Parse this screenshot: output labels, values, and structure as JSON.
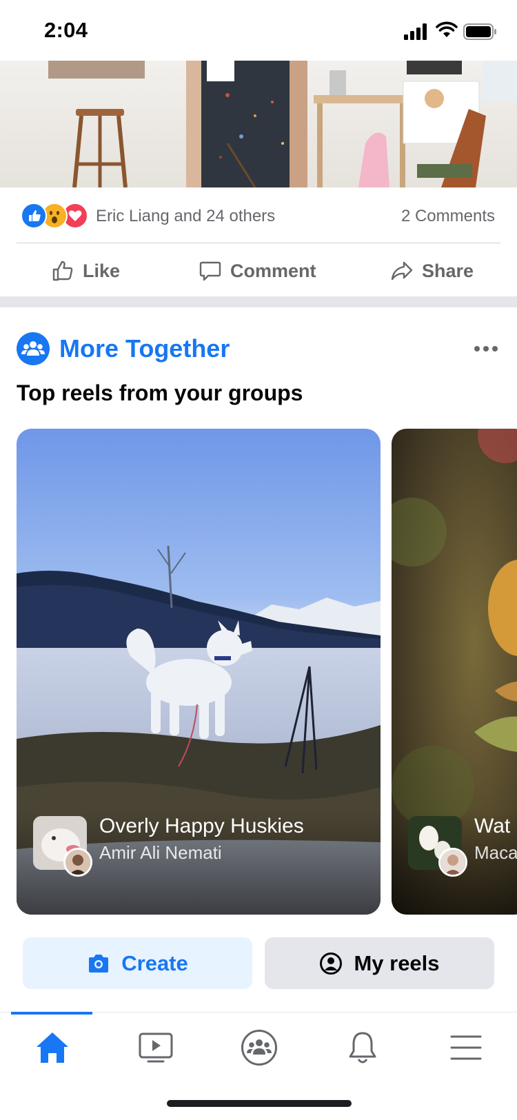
{
  "status_bar": {
    "time": "2:04"
  },
  "post": {
    "reactions_text": "Eric Liang and 24 others",
    "comments_text": "2 Comments",
    "actions": {
      "like": "Like",
      "comment": "Comment",
      "share": "Share"
    }
  },
  "group_section": {
    "title": "More Together",
    "subtitle": "Top reels from your groups",
    "reels": [
      {
        "title": "Overly Happy Huskies",
        "author": "Amir Ali Nemati"
      },
      {
        "title": "Wat",
        "author": "Maca"
      }
    ]
  },
  "buttons": {
    "create": "Create",
    "my_reels": "My reels"
  },
  "bottom_nav": [
    {
      "icon": "home-icon",
      "active": true
    },
    {
      "icon": "video-icon",
      "active": false
    },
    {
      "icon": "groups-icon",
      "active": false
    },
    {
      "icon": "bell-icon",
      "active": false
    },
    {
      "icon": "menu-icon",
      "active": false
    }
  ],
  "colors": {
    "accent": "#1877f2",
    "secondary_text": "#65676b",
    "separator": "#e4e6eb"
  }
}
